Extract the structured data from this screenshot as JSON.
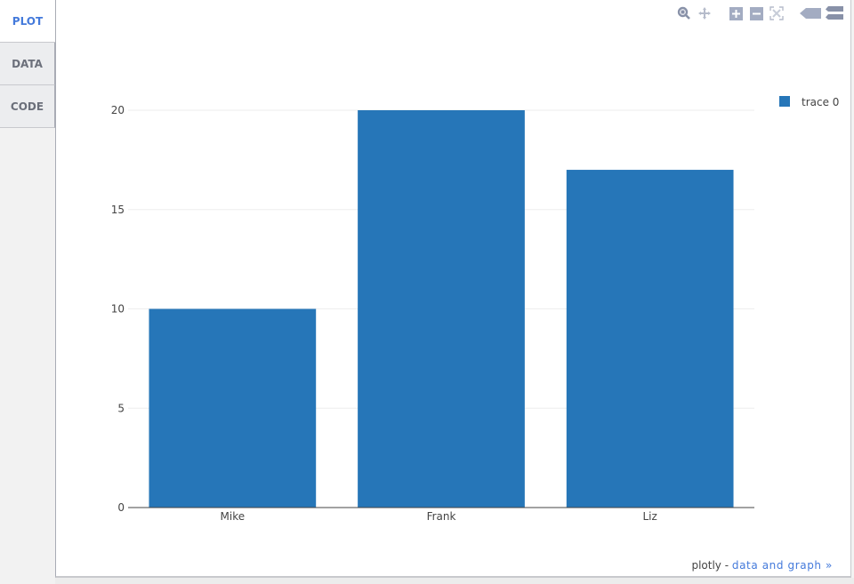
{
  "tabs": [
    {
      "label": "PLOT",
      "active": true
    },
    {
      "label": "DATA",
      "active": false
    },
    {
      "label": "CODE",
      "active": false
    }
  ],
  "modebar": {
    "icons": [
      "zoom-icon",
      "pan-icon",
      "zoom-in-icon",
      "zoom-out-icon",
      "autoscale-icon",
      "hover-closest-icon",
      "hover-compare-icon"
    ]
  },
  "footer": {
    "brand": "plotly",
    "separator": " - ",
    "link": "data and graph »"
  },
  "colors": {
    "bar": "#2676b8",
    "accent": "#447adb",
    "icon": "#a3acc2"
  },
  "chart_data": {
    "type": "bar",
    "categories": [
      "Mike",
      "Frank",
      "Liz"
    ],
    "series": [
      {
        "name": "trace 0",
        "values": [
          10,
          20,
          17
        ]
      }
    ],
    "title": "",
    "xlabel": "",
    "ylabel": "",
    "ylim": [
      0,
      20
    ],
    "yticks": [
      0,
      5,
      10,
      15,
      20
    ],
    "grid": true,
    "legend": "top-right"
  }
}
